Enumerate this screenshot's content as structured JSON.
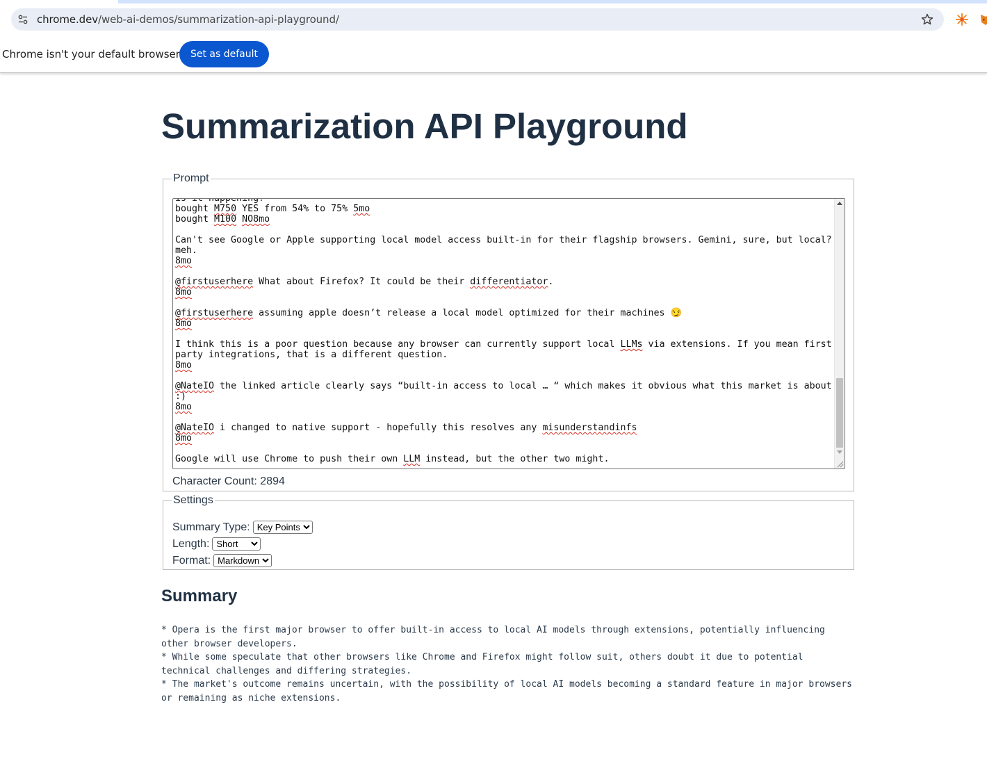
{
  "browser": {
    "url_host": "chrome.dev",
    "url_path": "/web-ai-demos/summarization-api-playground/",
    "infobar_message": "Chrome isn't your default browser",
    "infobar_button": "Set as default"
  },
  "page": {
    "title": "Summarization API Playground",
    "prompt_legend": "Prompt",
    "prompt_lines": [
      "is it happening? **",
      "bought M750 YES from 54% to 75% 5mo",
      "bought M100 NO8mo",
      "",
      "Can't see Google or Apple supporting local model access built-in for their flagship browsers. Gemini, sure, but local?",
      "meh.",
      "8mo",
      "",
      "@firstuserhere What about Firefox? It could be their differentiator.",
      "8mo",
      "",
      "@firstuserhere assuming apple doesn’t release a local model optimized for their machines 😏",
      "8mo",
      "",
      "I think this is a poor question because any browser can currently support local LLMs via extensions. If you mean first",
      "party integrations, that is a different question.",
      "8mo",
      "",
      "@NateIO the linked article clearly says “built-in access to local … “ which makes it obvious what this market is about",
      ":)",
      "8mo",
      "",
      "@NateIO i changed to native support - hopefully this resolves any misunderstandinfs",
      "8mo",
      "",
      "Google will use Chrome to push their own LLM instead, but the other two might."
    ],
    "character_count": "Character Count: 2894",
    "settings_legend": "Settings",
    "settings": {
      "summary_type_label": "Summary Type:",
      "summary_type_value": "Key Points",
      "length_label": "Length:",
      "length_value": "Short",
      "format_label": "Format:",
      "format_value": "Markdown"
    },
    "summary_heading": "Summary",
    "summary_text": "* Opera is the first major browser to offer built-in access to local AI models through extensions, potentially influencing\nother browser developers.\n* While some speculate that other browsers like Chrome and Firefox might follow suit, others doubt it due to potential\ntechnical challenges and differing strategies.\n* The market's outcome remains uncertain, with the possibility of local AI models becoming a standard feature in major browsers\nor remaining as niche extensions."
  },
  "icons": {
    "site_info": "tune-icon",
    "bookmark": "star-icon",
    "extension_1": "orange-spark-icon",
    "extension_2": "fox-extension-icon"
  },
  "colors": {
    "accent_button": "#0b57d0",
    "omnibox_bg": "#e9eef6",
    "heading_text": "#1f3044",
    "spellcheck": "#d93025"
  }
}
